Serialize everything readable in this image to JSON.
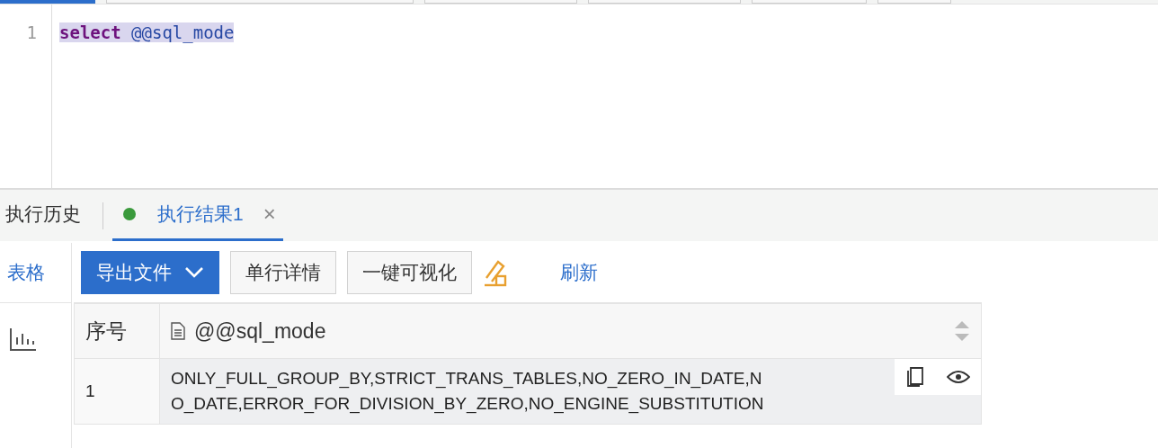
{
  "editor": {
    "lines": [
      {
        "number": "1",
        "keyword": "select",
        "rest": "@@sql_mode",
        "selected": true
      }
    ]
  },
  "result_tabs": [
    {
      "label": "执行历史",
      "selected": false
    },
    {
      "label": "执行结果1",
      "selected": true,
      "color": "#3a9a3c",
      "closable": true
    }
  ],
  "close_glyph": "×",
  "view_tabs": [
    {
      "label": "表格",
      "selected": true
    }
  ],
  "toolbar": [
    {
      "kind": "primary",
      "label": "导出文件",
      "dropdown": true
    },
    {
      "kind": "default",
      "label": "单行详情"
    },
    {
      "kind": "default",
      "label": "一键可视化"
    },
    {
      "kind": "icon"
    },
    {
      "kind": "link",
      "label": "刷新"
    }
  ],
  "table": {
    "columns": [
      "序号",
      "@@sql_mode"
    ],
    "rows": [
      {
        "index": "1",
        "value_lines": [
          "ONLY_FULL_GROUP_BY,STRICT_TRANS_TABLES,NO_ZERO_IN_DATE,N",
          "O_DATE,ERROR_FOR_DIVISION_BY_ZERO,NO_ENGINE_SUBSTITUTION"
        ],
        "hovered": true
      }
    ]
  }
}
